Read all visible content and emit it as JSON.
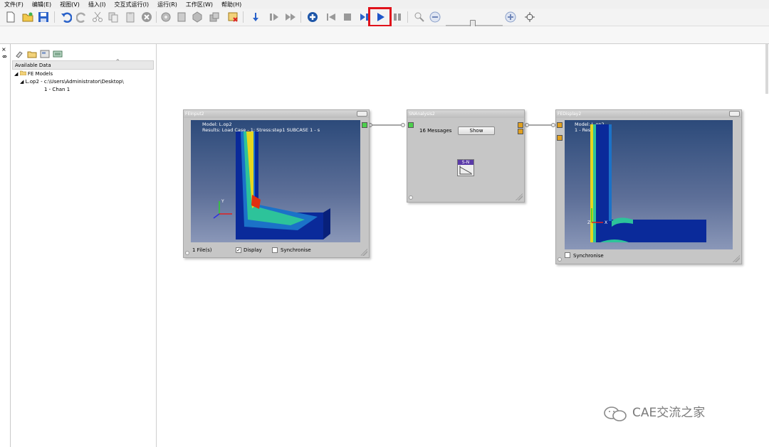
{
  "menu": [
    "文件(F)",
    "编辑(E)",
    "视图(V)",
    "插入(I)",
    "交互式运行(I)",
    "运行(R)",
    "工作区(W)",
    "帮助(H)"
  ],
  "left_panel": {
    "close_glyph": "×",
    "pin_glyph": "⇎",
    "header": "Available Data",
    "tree": {
      "root": "FE Models",
      "model": "L.op2 - c:\\Users\\Administrator\\Desktop\\",
      "channel": "1 - Chan 1"
    }
  },
  "nodes": {
    "fe_input": {
      "title": "FEInput2",
      "model_line": "Model:    L.op2",
      "results_line": "Results:  Load Case - 1: Stress:step1 SUBCASE 1 - s",
      "file_count": "1 File(s)",
      "display_label": "Display",
      "display_checked": true,
      "sync_label": "Synchronise",
      "sync_checked": false
    },
    "sn_analysis": {
      "title": "SNAnalysis2",
      "messages": "16 Messages",
      "show_label": "Show",
      "glyph_label": "S-N"
    },
    "fe_display": {
      "title": "FEDisplay2",
      "model_line": "Model:    L.op2",
      "results_line": "          1 - Results",
      "sync_label": "Synchronise",
      "sync_checked": false
    }
  },
  "watermark": "CAE交流之家",
  "colors": {
    "run_highlight": "#e0121b",
    "port_green": "#4cd04c",
    "port_orange": "#e0a020"
  }
}
